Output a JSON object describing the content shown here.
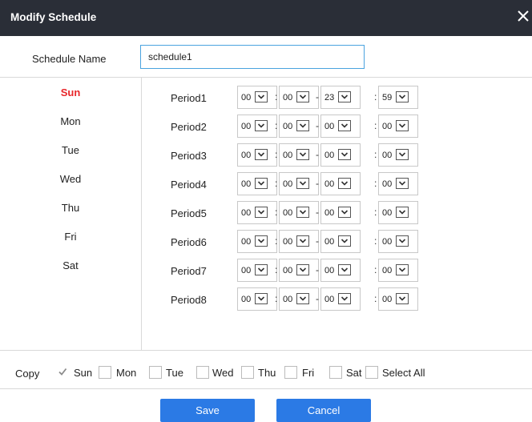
{
  "dialog": {
    "title": "Modify Schedule",
    "close_icon": "close-icon"
  },
  "schedule_name": {
    "label": "Schedule Name",
    "value": "schedule1"
  },
  "days": [
    {
      "label": "Sun",
      "active": true
    },
    {
      "label": "Mon",
      "active": false
    },
    {
      "label": "Tue",
      "active": false
    },
    {
      "label": "Wed",
      "active": false
    },
    {
      "label": "Thu",
      "active": false
    },
    {
      "label": "Fri",
      "active": false
    },
    {
      "label": "Sat",
      "active": false
    }
  ],
  "periods": [
    {
      "label": "Period1",
      "start_h": "00",
      "start_m": "00",
      "end_h": "23",
      "end_m": "59"
    },
    {
      "label": "Period2",
      "start_h": "00",
      "start_m": "00",
      "end_h": "00",
      "end_m": "00"
    },
    {
      "label": "Period3",
      "start_h": "00",
      "start_m": "00",
      "end_h": "00",
      "end_m": "00"
    },
    {
      "label": "Period4",
      "start_h": "00",
      "start_m": "00",
      "end_h": "00",
      "end_m": "00"
    },
    {
      "label": "Period5",
      "start_h": "00",
      "start_m": "00",
      "end_h": "00",
      "end_m": "00"
    },
    {
      "label": "Period6",
      "start_h": "00",
      "start_m": "00",
      "end_h": "00",
      "end_m": "00"
    },
    {
      "label": "Period7",
      "start_h": "00",
      "start_m": "00",
      "end_h": "00",
      "end_m": "00"
    },
    {
      "label": "Period8",
      "start_h": "00",
      "start_m": "00",
      "end_h": "00",
      "end_m": "00"
    }
  ],
  "separators": {
    "colon": ":",
    "dash": "-"
  },
  "copy": {
    "label": "Copy",
    "options": [
      {
        "label": "Sun",
        "checked": true
      },
      {
        "label": "Mon",
        "checked": false
      },
      {
        "label": "Tue",
        "checked": false
      },
      {
        "label": "Wed",
        "checked": false
      },
      {
        "label": "Thu",
        "checked": false
      },
      {
        "label": "Fri",
        "checked": false
      },
      {
        "label": "Sat",
        "checked": false
      },
      {
        "label": "Select All",
        "checked": false
      }
    ]
  },
  "buttons": {
    "save": "Save",
    "cancel": "Cancel"
  },
  "colors": {
    "titlebar": "#2a2e37",
    "accent": "#2b7ae5",
    "active_day": "#e8262a",
    "input_border": "#4aa3df"
  }
}
